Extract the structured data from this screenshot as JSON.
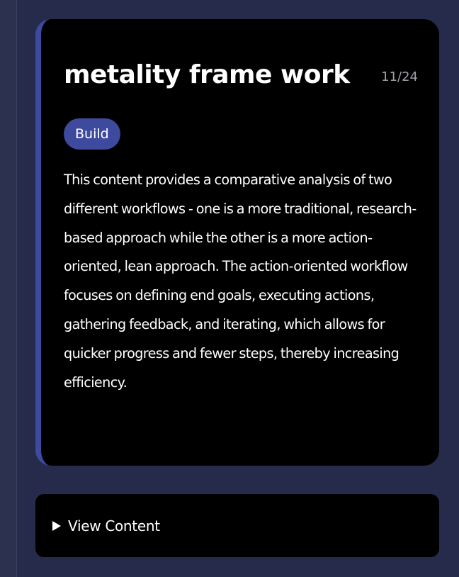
{
  "card": {
    "title": "metality frame work",
    "counter": "11/24",
    "tag": "Build",
    "description": "This content provides a comparative analysis of two different workflows - one is a more traditional, research-based approach while the other is a more action-oriented, lean approach. The action-oriented workflow focuses on defining end goals, executing actions, gathering feedback, and iterating, which allows for quicker progress and fewer steps, thereby increasing efficiency."
  },
  "expander": {
    "label": "View Content",
    "icon": "triangle-right-icon"
  },
  "colors": {
    "background": "#262b4c",
    "card_bg": "#000000",
    "accent": "#3d4a9e",
    "text": "#ffffff",
    "muted_text": "#a0a0a8"
  }
}
